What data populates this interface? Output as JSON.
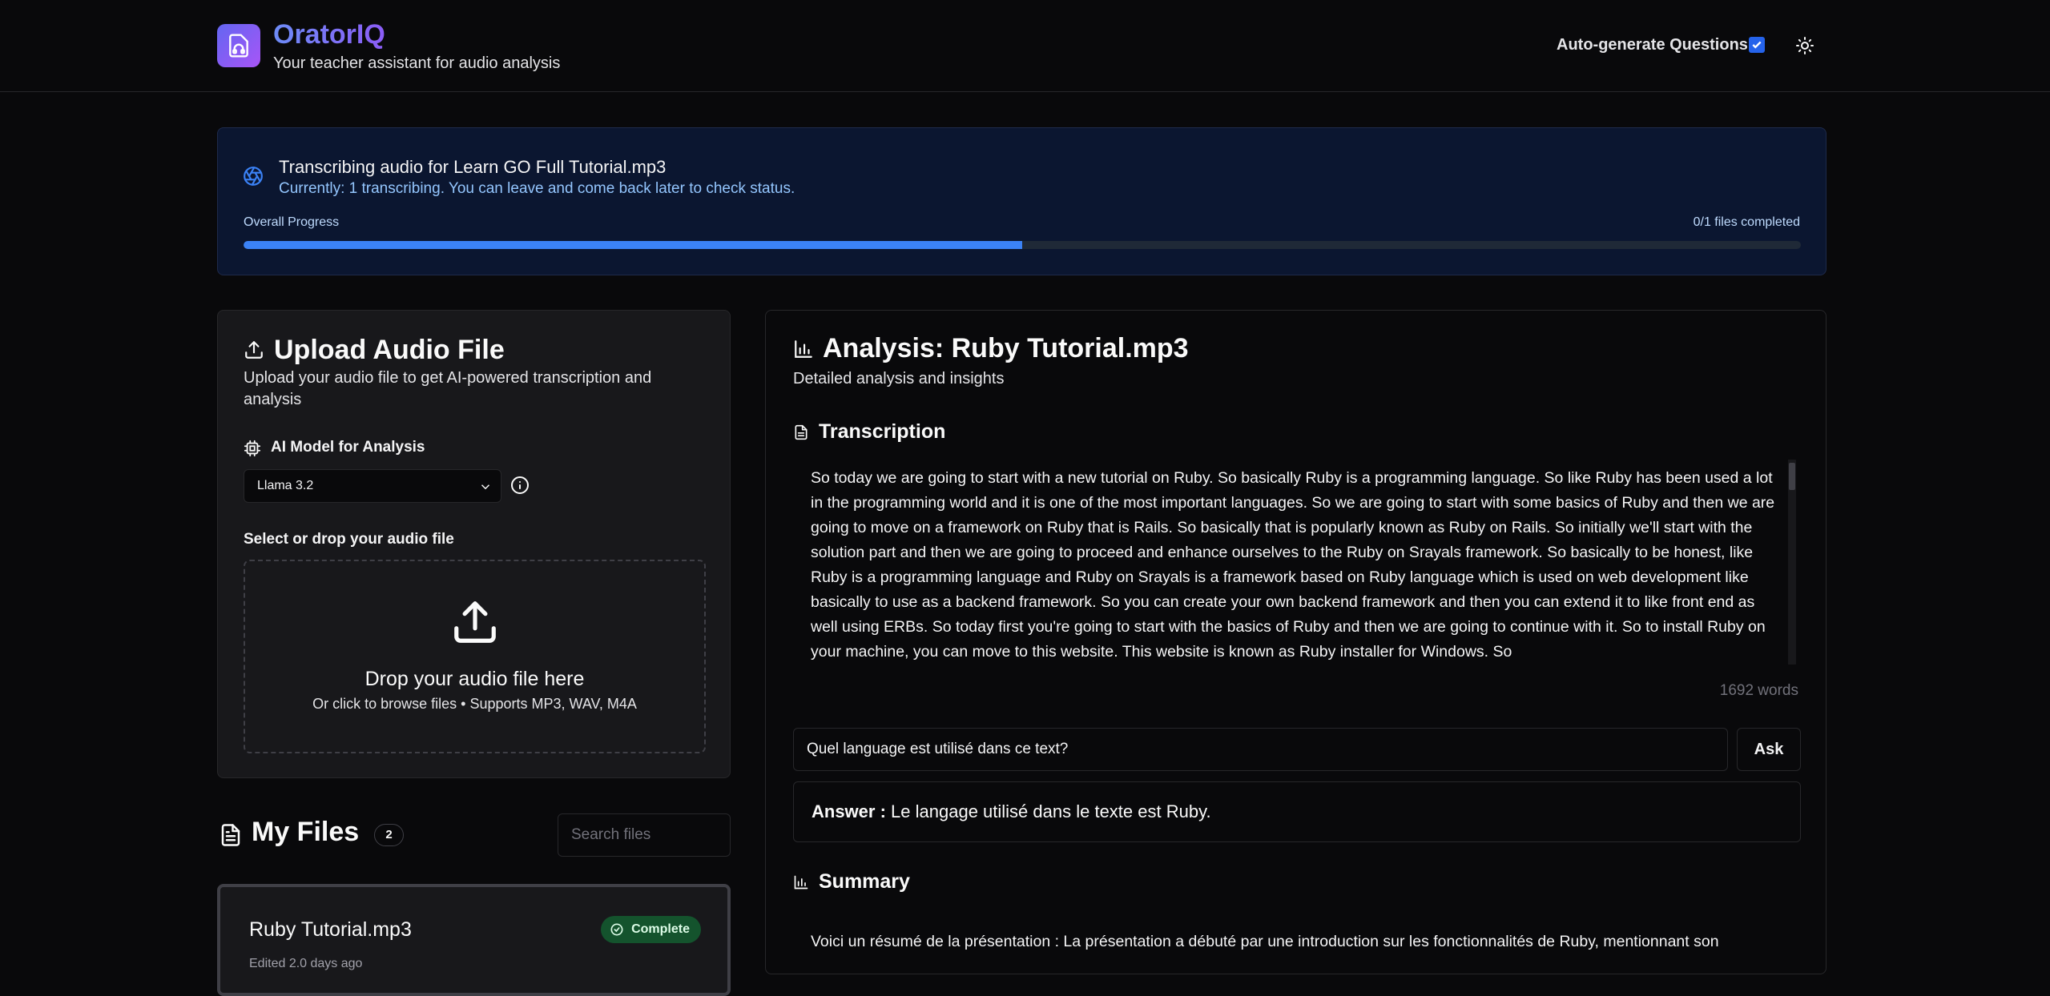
{
  "header": {
    "app_name": "OratorIQ",
    "tagline": "Your teacher assistant for audio analysis",
    "auto_generate_label": "Auto-generate Questions",
    "auto_generate_checked": true,
    "theme_icon": "sun-icon"
  },
  "progress": {
    "title": "Transcribing audio for Learn GO Full Tutorial.mp3",
    "status": "Currently: 1 transcribing. You can leave and come back later to check status.",
    "label": "Overall Progress",
    "count": "0/1 files completed",
    "fraction": 0.5
  },
  "upload": {
    "title": "Upload Audio File",
    "description": "Upload your audio file to get AI-powered transcription and analysis",
    "model_label": "AI Model for Analysis",
    "model_selected": "Llama 3.2",
    "drop_label": "Select or drop your audio file",
    "drop_title": "Drop your audio file here",
    "drop_sub": "Or click to browse files • Supports MP3, WAV, M4A"
  },
  "files": {
    "title": "My Files",
    "count": "2",
    "search_placeholder": "Search files",
    "items": [
      {
        "name": "Ruby Tutorial.mp3",
        "status": "Complete",
        "meta": "Edited 2.0 days ago"
      }
    ]
  },
  "analysis": {
    "title": "Analysis: Ruby Tutorial.mp3",
    "subtitle": "Detailed analysis and insights",
    "transcription_title": "Transcription",
    "transcription": "So today we are going to start with a new tutorial on Ruby. So basically Ruby is a programming language. So like Ruby has been used a lot in the programming world and it is one of the most important languages. So we are going to start with some basics of Ruby and then we are going to move on a framework on Ruby that is Rails. So basically that is popularly known as Ruby on Rails. So initially we'll start with the solution part and then we are going to proceed and enhance ourselves to the Ruby on Srayals framework. So basically to be honest, like Ruby is a programming language and Ruby on Srayals is a framework based on Ruby language which is used on web development like basically to use as a backend framework. So you can create your own backend framework and then you can extend it to like front end as well using ERBs. So today first you're going to start with the basics of Ruby and then we are going to continue with it. So to install Ruby on your machine, you can move to this website. This website is known as Ruby installer for Windows. So",
    "word_count": "1692 words",
    "question_value": "Quel language est utilisé dans ce text?",
    "ask_label": "Ask",
    "answer_label": "Answer :",
    "answer_text": "Le langage utilisé dans le texte est Ruby.",
    "summary_title": "Summary",
    "summary": "Voici un résumé de la présentation : La présentation a débuté par une introduction sur les fonctionnalités de Ruby, mentionnant son"
  },
  "colors": {
    "accent": "#3b82f6",
    "brand_gradient_start": "#6366f1",
    "brand_gradient_end": "#a855f7",
    "success": "#14532d"
  }
}
